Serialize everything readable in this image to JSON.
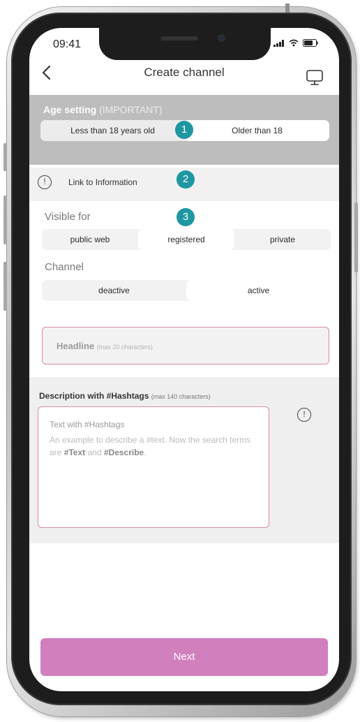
{
  "status_bar": {
    "time": "09:41"
  },
  "header": {
    "title": "Create channel"
  },
  "age_setting": {
    "title": "Age setting",
    "note": "(IMPORTANT)",
    "options": [
      "Less than 18 years old",
      "Older than 18"
    ],
    "selected": "Older than 18"
  },
  "badges": [
    "1",
    "2",
    "3"
  ],
  "info_link": {
    "label": "Link to Information"
  },
  "visible_for": {
    "label": "Visible for",
    "options": [
      "public web",
      "registered",
      "private"
    ],
    "selected": "registered"
  },
  "channel": {
    "label": "Channel",
    "options": [
      "deactive",
      "active"
    ],
    "selected": "active"
  },
  "headline": {
    "placeholder": "Headline",
    "hint": "(max 20 characters)"
  },
  "description": {
    "label": "Description with #Hashtags",
    "hint": "(max 140 characters)",
    "placeholder_title": "Text with #Hashtags",
    "placeholder_text_1": "An example to describe a #text. Now the search terms are ",
    "placeholder_term_1": "#Text",
    "placeholder_and": " and ",
    "placeholder_term_2": "#Describe",
    "placeholder_end": "."
  },
  "next_button": {
    "label": "Next"
  },
  "colors": {
    "accent": "#d27fbd",
    "badge": "#1e97a1",
    "field_border": "#d68aa4",
    "section_gray": "#bdbdbd"
  },
  "icons": [
    "chevron-left-icon",
    "monitor-icon",
    "info-icon",
    "signal-icon",
    "wifi-icon",
    "battery-icon"
  ]
}
